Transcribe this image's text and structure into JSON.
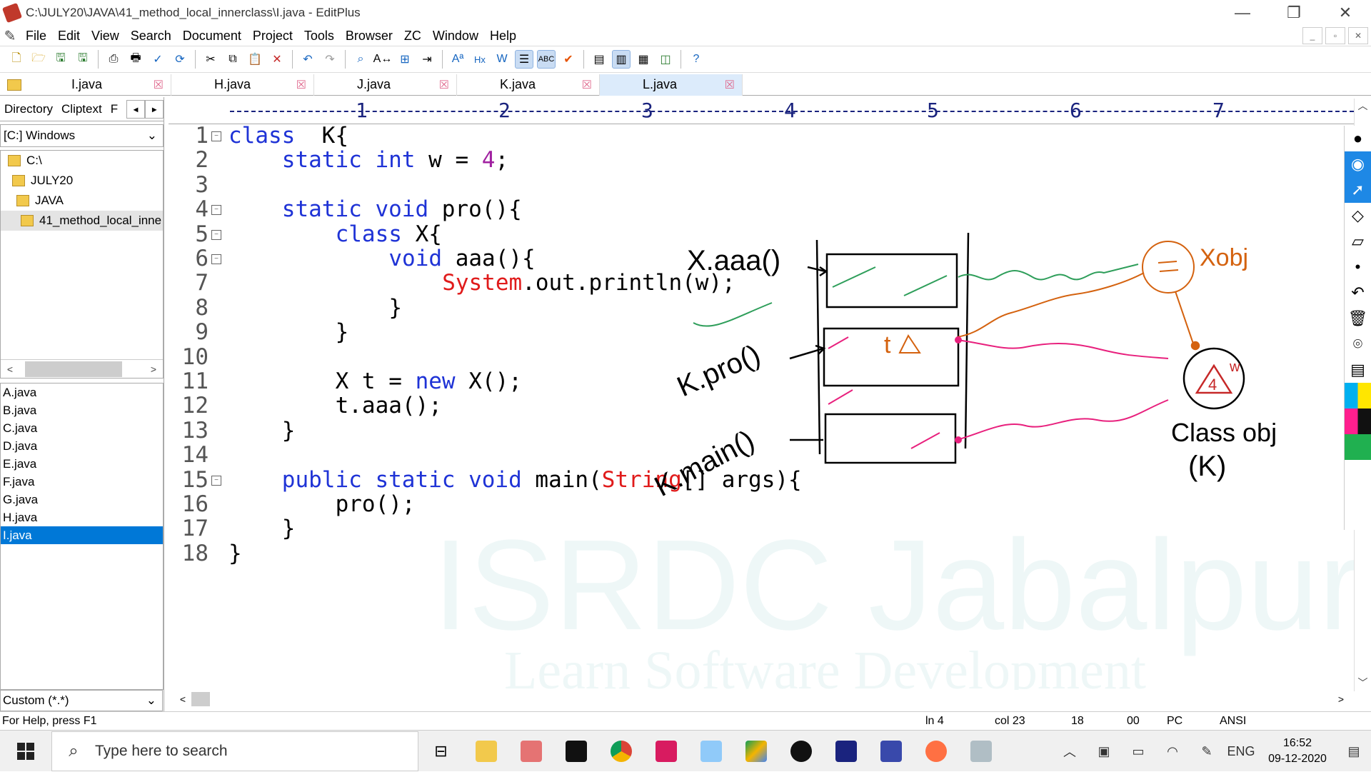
{
  "window": {
    "title": "C:\\JULY20\\JAVA\\41_method_local_innerclass\\I.java - EditPlus",
    "controls": [
      "—",
      "❐",
      "✕"
    ]
  },
  "menu": [
    "File",
    "Edit",
    "View",
    "Search",
    "Document",
    "Project",
    "Tools",
    "Browser",
    "ZC",
    "Window",
    "Help"
  ],
  "tabs": [
    {
      "label": "I.java",
      "active": false
    },
    {
      "label": "H.java",
      "active": false
    },
    {
      "label": "J.java",
      "active": false
    },
    {
      "label": "K.java",
      "active": false
    },
    {
      "label": "L.java",
      "active": true
    }
  ],
  "sidebar": {
    "tabs": [
      "Directory",
      "Cliptext",
      "F"
    ],
    "drive": "[C:] Windows",
    "tree": [
      "C:\\",
      "JULY20",
      "JAVA",
      "41_method_local_inne"
    ],
    "files": [
      "A.java",
      "B.java",
      "C.java",
      "D.java",
      "E.java",
      "F.java",
      "G.java",
      "H.java",
      "I.java"
    ],
    "selected_file": "I.java",
    "filter": "Custom (*.*)"
  },
  "ruler": [
    "1",
    "2",
    "3",
    "4",
    "5",
    "6",
    "7"
  ],
  "code": [
    {
      "n": "1",
      "fold": true,
      "indent": 0,
      "toks": [
        [
          "kw",
          "class"
        ],
        [
          "",
          "  K{"
        ]
      ]
    },
    {
      "n": "2",
      "fold": false,
      "indent": 1,
      "toks": [
        [
          "kw",
          "static"
        ],
        [
          "",
          " "
        ],
        [
          "kw",
          "int"
        ],
        [
          "",
          " w = "
        ],
        [
          "num",
          "4"
        ],
        [
          "",
          ";"
        ]
      ]
    },
    {
      "n": "3",
      "fold": false,
      "indent": 0,
      "toks": []
    },
    {
      "n": "4",
      "fold": true,
      "indent": 1,
      "toks": [
        [
          "kw",
          "static"
        ],
        [
          "",
          " "
        ],
        [
          "kw",
          "void"
        ],
        [
          "",
          " pro(){"
        ]
      ]
    },
    {
      "n": "5",
      "fold": true,
      "indent": 2,
      "toks": [
        [
          "kw",
          "class"
        ],
        [
          "",
          " X{"
        ]
      ]
    },
    {
      "n": "6",
      "fold": true,
      "indent": 3,
      "toks": [
        [
          "kw",
          "void"
        ],
        [
          "",
          " aaa(){"
        ]
      ]
    },
    {
      "n": "7",
      "fold": false,
      "indent": 4,
      "toks": [
        [
          "str",
          "System"
        ],
        [
          "",
          ".out.println(w);"
        ]
      ]
    },
    {
      "n": "8",
      "fold": false,
      "indent": 3,
      "toks": [
        [
          "",
          "}"
        ]
      ]
    },
    {
      "n": "9",
      "fold": false,
      "indent": 2,
      "toks": [
        [
          "",
          "}"
        ]
      ]
    },
    {
      "n": "10",
      "fold": false,
      "indent": 0,
      "toks": []
    },
    {
      "n": "11",
      "fold": false,
      "indent": 2,
      "toks": [
        [
          "",
          "X t = "
        ],
        [
          "kw",
          "new"
        ],
        [
          "",
          " X();"
        ]
      ]
    },
    {
      "n": "12",
      "fold": false,
      "indent": 2,
      "toks": [
        [
          "",
          "t.aaa();"
        ]
      ]
    },
    {
      "n": "13",
      "fold": false,
      "indent": 1,
      "toks": [
        [
          "",
          "}"
        ]
      ]
    },
    {
      "n": "14",
      "fold": false,
      "indent": 0,
      "toks": []
    },
    {
      "n": "15",
      "fold": true,
      "indent": 1,
      "toks": [
        [
          "kw",
          "public"
        ],
        [
          "",
          " "
        ],
        [
          "kw",
          "static"
        ],
        [
          "",
          " "
        ],
        [
          "kw",
          "void"
        ],
        [
          "",
          " main("
        ],
        [
          "str",
          "String"
        ],
        [
          "",
          "[] args){"
        ]
      ]
    },
    {
      "n": "16",
      "fold": false,
      "indent": 2,
      "toks": [
        [
          "",
          "pro();"
        ]
      ]
    },
    {
      "n": "17",
      "fold": false,
      "indent": 1,
      "toks": [
        [
          "",
          "}"
        ]
      ]
    },
    {
      "n": "18",
      "fold": false,
      "indent": 0,
      "toks": [
        [
          "",
          "}"
        ]
      ]
    }
  ],
  "watermark": {
    "line1": "ISRDC Jabalpur",
    "line2": "Learn Software Development"
  },
  "annotations": {
    "x_aaa": "X.aaa()",
    "k_pro": "K.pro()",
    "k_main": "K.main()",
    "t_label": "t",
    "x_obj": "Xobj",
    "class_obj": "Class obj",
    "class_obj_k": "(K)",
    "w_label": "w",
    "four_label": "4"
  },
  "status": {
    "help": "For Help, press F1",
    "ln": "ln 4",
    "col": "col 23",
    "lines": "18",
    "code": "00",
    "mode": "PC",
    "enc": "ANSI"
  },
  "taskbar": {
    "search_placeholder": "Type here to search",
    "lang": "ENG",
    "time": "16:52",
    "date": "09-12-2020"
  }
}
